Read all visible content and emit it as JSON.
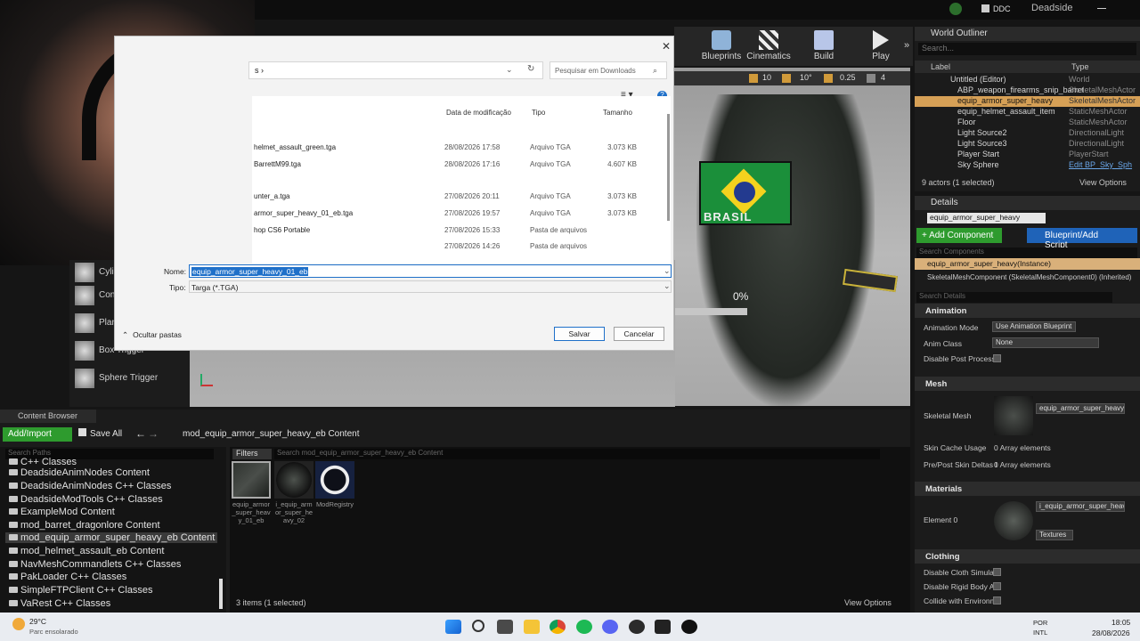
{
  "topbar": {
    "ddc_label": "DDC",
    "project_name": "Deadside"
  },
  "toolbar": {
    "items": [
      "Blueprints",
      "Cinematics",
      "Build",
      "Play"
    ]
  },
  "viewport_controls": {
    "snap_grid": "10",
    "snap_angle": "10°",
    "snap_scale": "0.25",
    "camera_speed": "4"
  },
  "viewport": {
    "overlay_percent": "0%",
    "flag_text": "BRASIL"
  },
  "place_panel": {
    "items": [
      "Cylinder",
      "Cone",
      "Plane",
      "Box Trigger",
      "Sphere Trigger"
    ]
  },
  "world_outliner": {
    "tab": "World Outliner",
    "search_placeholder": "Search...",
    "col_label": "Label",
    "col_type": "Type",
    "rows": [
      {
        "label": "Untitled (Editor)",
        "type": "World"
      },
      {
        "label": "ABP_weapon_firearms_snip_barret",
        "type": "SkeletalMeshActor"
      },
      {
        "label": "equip_armor_super_heavy",
        "type": "SkeletalMeshActor"
      },
      {
        "label": "equip_helmet_assault_item",
        "type": "StaticMeshActor"
      },
      {
        "label": "Floor",
        "type": "StaticMeshActor"
      },
      {
        "label": "Light Source2",
        "type": "DirectionalLight"
      },
      {
        "label": "Light Source3",
        "type": "DirectionalLight"
      },
      {
        "label": "Player Start",
        "type": "PlayerStart"
      },
      {
        "label": "Sky Sphere",
        "type": "Edit BP_Sky_Sph"
      }
    ],
    "actor_count": "9 actors (1 selected)",
    "view_options": "View Options"
  },
  "details": {
    "tab": "Details",
    "name_value": "equip_armor_super_heavy",
    "add_component": "+ Add Component",
    "blueprint_button": "Blueprint/Add Script",
    "search_components_placeholder": "Search Components",
    "instance_row": "equip_armor_super_heavy(Instance)",
    "component_row": "SkeletalMeshComponent (SkeletalMeshComponent0) (Inherited)",
    "search_details_placeholder": "Search Details",
    "animation_section": "Animation",
    "anim_mode_label": "Animation Mode",
    "anim_mode_value": "Use Animation Blueprint",
    "anim_class_label": "Anim Class",
    "anim_class_value": "None",
    "disable_post_label": "Disable Post Process",
    "mesh_section": "Mesh",
    "skeletal_mesh_label": "Skeletal Mesh",
    "skeletal_mesh_value": "equip_armor_super_heavy",
    "skin_cache_label": "Skin Cache Usage",
    "skin_cache_value": "0 Array elements",
    "pre_post_label": "Pre/Post Skin Deltas I",
    "pre_post_value": "0 Array elements",
    "materials_section": "Materials",
    "element0_label": "Element 0",
    "element0_value": "i_equip_armor_super_heavy",
    "textures_label": "Textures",
    "clothing_section": "Clothing",
    "cloth_sim_label": "Disable Cloth Simulati",
    "rigid_body_label": "Disable Rigid Body Ani",
    "collide_env_label": "Collide with Environme"
  },
  "content_browser": {
    "tab": "Content Browser",
    "add_import": "Add/Import",
    "save_all": "Save All",
    "path": "mod_equip_armor_super_heavy_eb Content",
    "search_paths_placeholder": "Search Paths",
    "filters": "Filters",
    "search_assets_placeholder": "Search mod_equip_armor_super_heavy_eb Content",
    "tree": [
      "C++ Classes",
      "DeadsideAnimNodes Content",
      "DeadsideAnimNodes C++ Classes",
      "DeadsideModTools C++ Classes",
      "ExampleMod Content",
      "mod_barret_dragonlore Content",
      "mod_equip_armor_super_heavy_eb Content",
      "mod_helmet_assault_eb Content",
      "NavMeshCommandlets C++ Classes",
      "PakLoader C++ Classes",
      "SimpleFTPClient C++ Classes",
      "VaRest C++ Classes"
    ],
    "assets": [
      {
        "name": "equip_armor_super_heavy_01_eb"
      },
      {
        "name": "i_equip_armor_super_heavy_02"
      },
      {
        "name": "ModRegistry"
      }
    ],
    "item_count": "3 items (1 selected)",
    "view_options": "View Options"
  },
  "dialog": {
    "path_crumb": "s  ›",
    "search_placeholder": "Pesquisar em Downloads",
    "col_date": "Data de modificação",
    "col_type": "Tipo",
    "col_size": "Tamanho",
    "files": [
      {
        "name": "helmet_assault_green.tga",
        "date": "28/08/2026 17:58",
        "type": "Arquivo TGA",
        "size": "3.073 KB"
      },
      {
        "name": "BarrettM99.tga",
        "date": "28/08/2026 17:16",
        "type": "Arquivo TGA",
        "size": "4.607 KB"
      },
      {
        "name": "unter_a.tga",
        "date": "27/08/2026 20:11",
        "type": "Arquivo TGA",
        "size": "3.073 KB"
      },
      {
        "name": "armor_super_heavy_01_eb.tga",
        "date": "27/08/2026 19:57",
        "type": "Arquivo TGA",
        "size": "3.073 KB"
      },
      {
        "name": "hop CS6 Portable",
        "date": "27/08/2026 15:33",
        "type": "Pasta de arquivos",
        "size": ""
      },
      {
        "name": "",
        "date": "27/08/2026 14:26",
        "type": "Pasta de arquivos",
        "size": ""
      }
    ],
    "name_label": "Nome:",
    "name_value": "equip_armor_super_heavy_01_eb",
    "type_label": "Tipo:",
    "type_value": "Targa (*.TGA)",
    "hide_folders": "Ocultar pastas",
    "save": "Salvar",
    "cancel": "Cancelar"
  },
  "taskbar": {
    "weather_temp": "29°C",
    "weather_desc": "Parc ensolarado",
    "lang_top": "POR",
    "lang_bottom": "INTL",
    "time": "18:05",
    "date": "28/08/2026"
  },
  "colors": {
    "ue_dark": "#1b1b1b",
    "selection_orange": "#d6a056",
    "add_green": "#2e9b2e",
    "blueprint_blue": "#1f63b8"
  }
}
